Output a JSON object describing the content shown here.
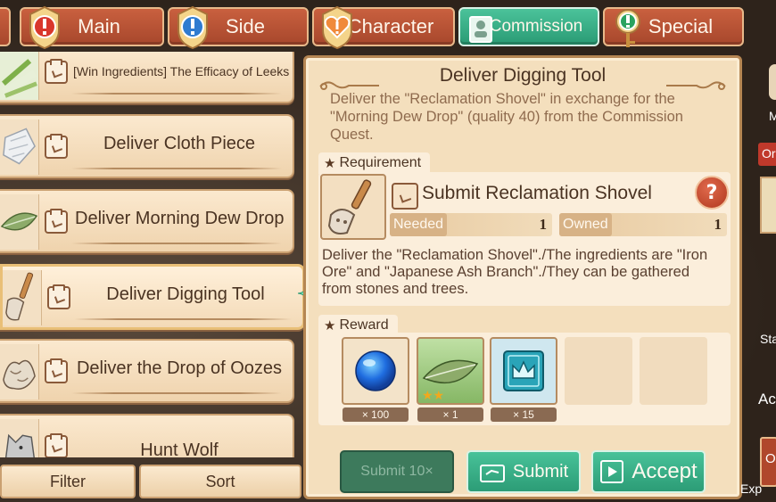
{
  "tabs": [
    {
      "label": "Main",
      "icon": "exclamation-badge-icon",
      "active": false
    },
    {
      "label": "Side",
      "icon": "exclamation-badge-icon",
      "active": false
    },
    {
      "label": "Character",
      "icon": "heart-badge-icon",
      "active": false
    },
    {
      "label": "Commission",
      "icon": "commission-scroll-icon",
      "active": true
    },
    {
      "label": "Special",
      "icon": "key-badge-icon",
      "active": false
    }
  ],
  "quest_list": [
    {
      "title": "[Win Ingredients] The Efficacy of Leeks",
      "thumb": "leek-icon"
    },
    {
      "title": "Deliver Cloth Piece",
      "thumb": "cloth-icon"
    },
    {
      "title": "Deliver Morning Dew Drop",
      "thumb": "leaf-icon"
    },
    {
      "title": "Deliver Digging Tool",
      "thumb": "shovel-icon"
    },
    {
      "title": "Deliver the Drop of Oozes",
      "thumb": "ooze-icon"
    },
    {
      "title": "Hunt Wolf",
      "thumb": "wolf-icon"
    }
  ],
  "bottom": {
    "filter": "Filter",
    "sort": "Sort"
  },
  "detail": {
    "title": "Deliver Digging Tool",
    "description": "Deliver the \"Reclamation Shovel\" in exchange for the \"Morning Dew Drop\" (quality 40) from the Commission Quest.",
    "requirement_label": "Requirement",
    "requirement_title": "Submit Reclamation Shovel",
    "help": "?",
    "needed_label": "Needed",
    "needed_value": "1",
    "owned_label": "Owned",
    "owned_value": "1",
    "requirement_desc": "Deliver the \"Reclamation Shovel\"./The ingredients are \"Iron Ore\" and \"Japanese Ash Branch\"./They can be gathered from stones and trees.",
    "reward_label": "Reward",
    "rewards": [
      {
        "icon": "blue-orb-icon",
        "count": "× 100",
        "stars": 0
      },
      {
        "icon": "leaf-icon",
        "count": "× 1",
        "stars": 2
      },
      {
        "icon": "crown-card-icon",
        "count": "× 15",
        "stars": 0
      }
    ],
    "buttons": {
      "submit10": "Submit 10×",
      "submit": "Submit",
      "accept": "Accept"
    }
  },
  "right_strip": {
    "t1": "M",
    "t2": "Or",
    "t3": "Sta",
    "t4": "Ac",
    "t5": "O",
    "t6": "Exp"
  },
  "colors": {
    "accent_green": "#2c9c76",
    "tab_red": "#a7472c",
    "panel": "#f4dfbd"
  }
}
